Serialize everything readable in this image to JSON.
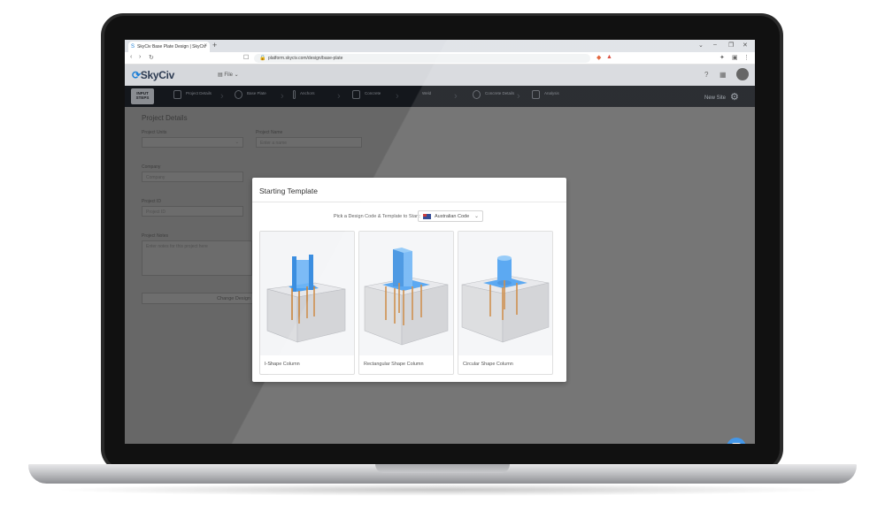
{
  "browser": {
    "tab_title": "SkyCiv Base Plate Design | SkyCiv",
    "tab_close": "×",
    "new_tab": "+",
    "url": "platform.skyciv.com/design/base-plate",
    "window_controls": [
      "⌄",
      "–",
      "❐",
      "✕"
    ]
  },
  "app": {
    "logo": "SkyCiv",
    "file_menu": "File",
    "new_site": "New Site",
    "steps": [
      {
        "label": "INPUT STEPS"
      },
      {
        "label": "Project Details"
      },
      {
        "label": "Base Plate"
      },
      {
        "label": "Anchors"
      },
      {
        "label": "Concrete"
      },
      {
        "label": "Weld"
      },
      {
        "label": "Concrete Details"
      },
      {
        "label": "Analysis"
      }
    ]
  },
  "form": {
    "title": "Project Details",
    "project_units_label": "Project Units",
    "project_name_label": "Project Name",
    "project_name_placeholder": "Enter a name",
    "company_label": "Company",
    "company_placeholder": "Company",
    "project_id_label": "Project ID",
    "project_id_placeholder": "Project ID",
    "project_notes_label": "Project Notes",
    "project_notes_placeholder": "Enter notes for this project here",
    "change_button": "Change Design"
  },
  "modal": {
    "title": "Starting Template",
    "pick_label": "Pick a Design Code & Template to Start:",
    "design_code": "Australian Code",
    "templates": [
      {
        "label": "I-Shape Column"
      },
      {
        "label": "Rectangular Shape Column"
      },
      {
        "label": "Circular Shape Column"
      }
    ]
  },
  "colors": {
    "accent": "#1e7fd6",
    "column_blue": "#4a9ff0",
    "anchor_orange": "#c9853c",
    "concrete": "#d9dadd"
  }
}
